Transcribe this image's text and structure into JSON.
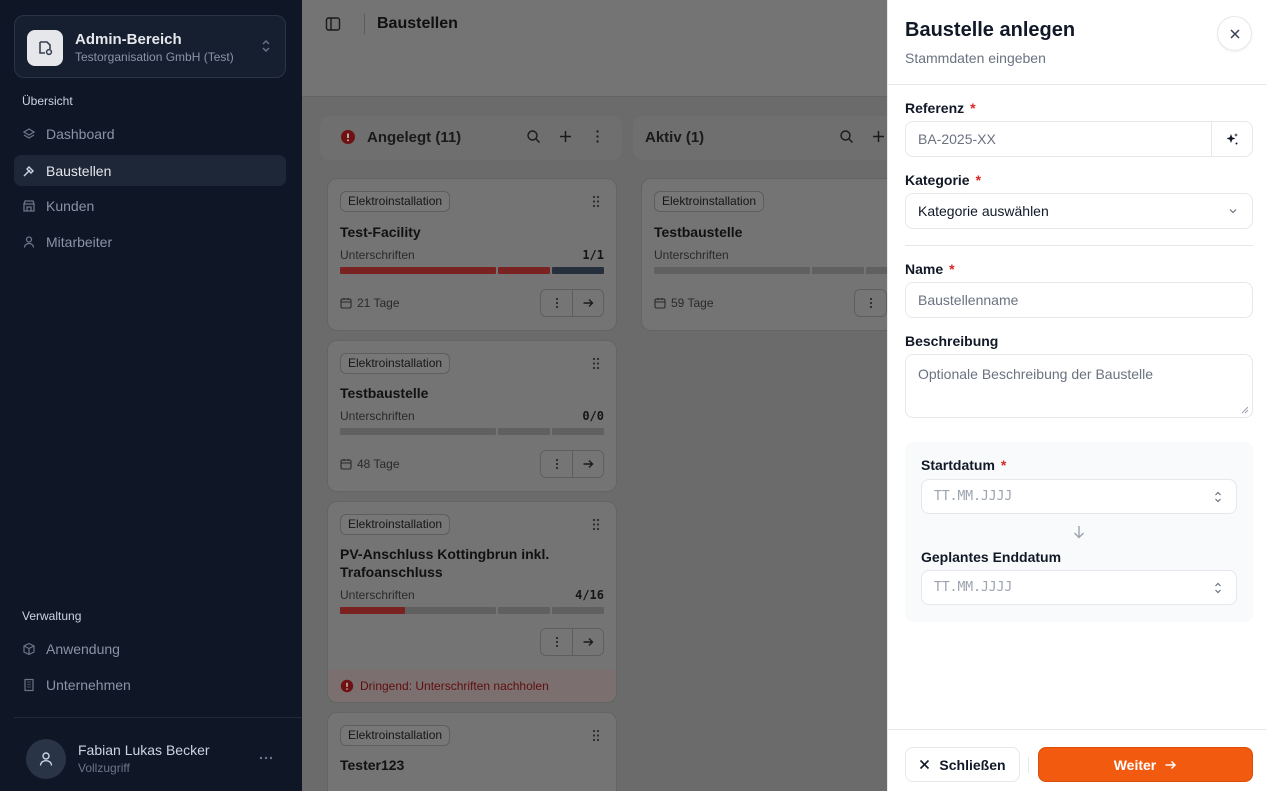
{
  "sidebar": {
    "org_title": "Admin-Bereich",
    "org_subtitle": "Testorganisation GmbH (Test)",
    "section_overview": "Übersicht",
    "nav": [
      {
        "label": "Dashboard",
        "icon": "layers-icon"
      },
      {
        "label": "Baustellen",
        "icon": "hammer-icon",
        "active": true
      },
      {
        "label": "Kunden",
        "icon": "store-icon"
      },
      {
        "label": "Mitarbeiter",
        "icon": "user-icon"
      }
    ],
    "section_admin": "Verwaltung",
    "admin_nav": [
      {
        "label": "Anwendung",
        "icon": "box-icon"
      },
      {
        "label": "Unternehmen",
        "icon": "building-icon"
      }
    ],
    "user": {
      "name": "Fabian Lukas Becker",
      "role": "Vollzugriff"
    }
  },
  "main": {
    "title": "Baustellen",
    "columns": [
      {
        "title": "Angelegt (11)"
      },
      {
        "title": "Aktiv (1)"
      }
    ],
    "cards": [
      {
        "tag": "Elektroinstallation",
        "title": "Test-Facility",
        "sig_label": "Unterschriften",
        "sig_count": "1/1",
        "days": "21 Tage",
        "progress": 1.0
      },
      {
        "tag": "Elektroinstallation",
        "title": "Testbaustelle",
        "sig_label": "Unterschriften",
        "sig_count": "0/0",
        "days": "48 Tage",
        "progress": 0
      },
      {
        "tag": "Elektroinstallation",
        "title": "PV-Anschluss Kottingbrun inkl. Trafoanschluss",
        "sig_label": "Unterschriften",
        "sig_count": "4/16",
        "progress": 0.25,
        "urgent": "Dringend: Unterschriften nachholen"
      },
      {
        "tag": "Elektroinstallation",
        "title": "Tester123"
      },
      {
        "tag": "Elektroinstallation",
        "title": "Testbaustelle",
        "sig_label": "Unterschriften",
        "days": "59 Tage",
        "progress": 0
      }
    ]
  },
  "drawer": {
    "title": "Baustelle anlegen",
    "subtitle": "Stammdaten eingeben",
    "referenz_label": "Referenz",
    "referenz_placeholder": "BA-2025-XX",
    "kategorie_label": "Kategorie",
    "kategorie_value": "Kategorie auswählen",
    "name_label": "Name",
    "name_placeholder": "Baustellenname",
    "beschreibung_label": "Beschreibung",
    "beschreibung_placeholder": "Optionale Beschreibung der Baustelle",
    "start_label": "Startdatum",
    "start_placeholder": "TT.MM.JJJJ",
    "end_label": "Geplantes Enddatum",
    "end_placeholder": "TT.MM.JJJJ",
    "required_mark": "*",
    "close_label": "Schließen",
    "next_label": "Weiter"
  },
  "colors": {
    "accent": "#f15a0f",
    "sidebar_bg": "#0f1626",
    "required": "#dc2626"
  }
}
